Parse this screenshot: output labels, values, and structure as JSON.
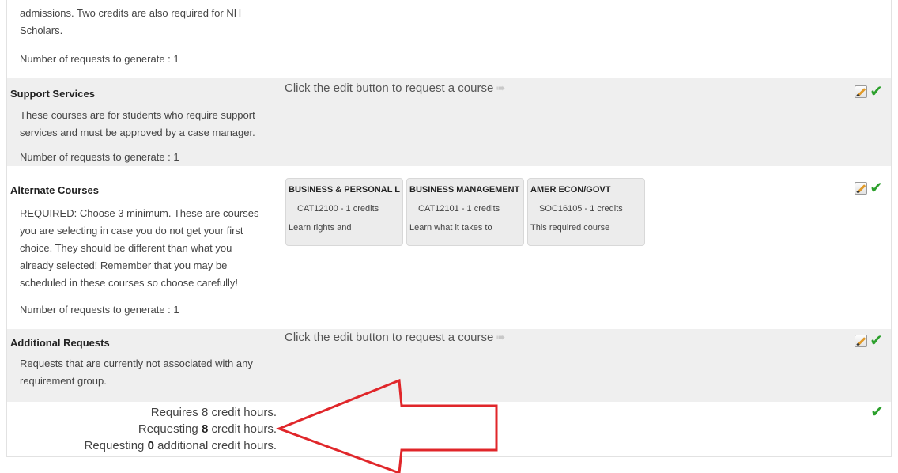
{
  "top_section": {
    "desc_line1": "admissions. Two credits are also required for NH",
    "desc_line2": "Scholars.",
    "num_requests": "Number of requests to generate : 1"
  },
  "support_services": {
    "title": "Support Services",
    "message": "Click the edit button to request a course",
    "desc_line1": "These courses are for students who require support",
    "desc_line2": "services and must be approved by a case manager.",
    "num_requests": "Number of requests to generate : 1"
  },
  "alternate_courses": {
    "title": "Alternate Courses",
    "desc_lines": [
      "REQUIRED: Choose 3 minimum. These are courses",
      "you are selecting in case you do not get your first",
      "choice. They should be different than what you",
      "already selected! Remember that you may be",
      "scheduled in these courses so choose carefully!"
    ],
    "num_requests": "Number of requests to generate : 1",
    "cards": [
      {
        "title": "BUSINESS & PERSONAL L",
        "code": "CAT12100 - 1 credits",
        "desc": "Learn rights and"
      },
      {
        "title": "BUSINESS MANAGEMENT",
        "code": "CAT12101 - 1 credits",
        "desc": "Learn what it takes to"
      },
      {
        "title": "AMER ECON/GOVT",
        "code": "SOC16105 - 1 credits",
        "desc": "This required course"
      }
    ]
  },
  "additional_requests": {
    "title": "Additional Requests",
    "message": "Click the edit button to request a course",
    "desc_line1": "Requests that are currently not associated with any",
    "desc_line2": "requirement group."
  },
  "summary": {
    "requires": "Requires 8 credit hours.",
    "requesting_prefix": "Requesting ",
    "requesting_value": "8",
    "requesting_suffix": " credit hours.",
    "additional_prefix": "Requesting ",
    "additional_value": "0",
    "additional_suffix": " additional credit hours."
  },
  "colors": {
    "check": "#2ca02c",
    "annotation_arrow": "#e0262a",
    "section_bg": "#efefef"
  },
  "icons": {
    "edit": "edit-pencil-icon",
    "check": "check-icon",
    "inline_arrow": "arrow-right-icon"
  }
}
